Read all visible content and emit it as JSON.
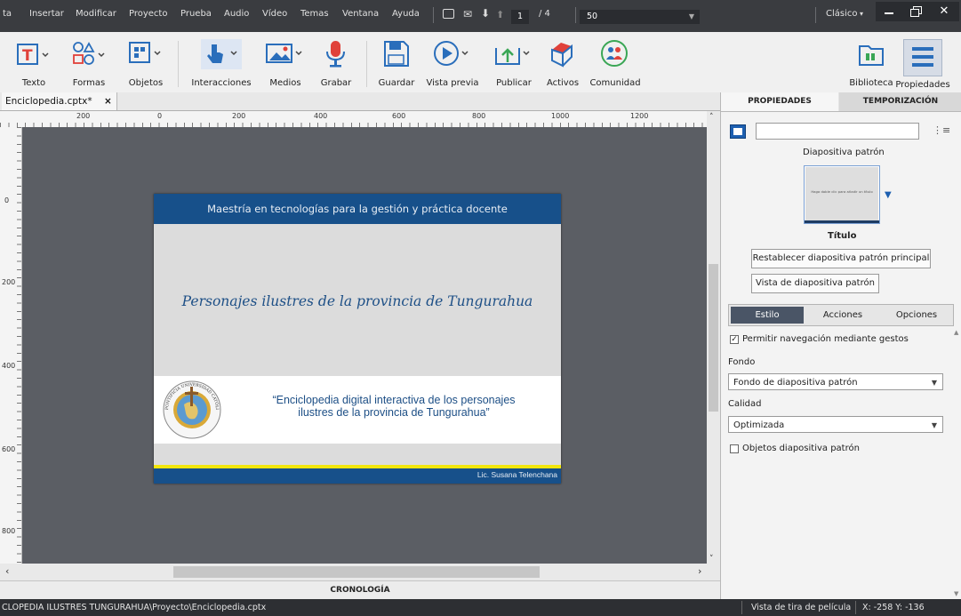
{
  "menubar": {
    "items": [
      "ta",
      "Insertar",
      "Modificar",
      "Proyecto",
      "Prueba",
      "Audio",
      "Vídeo",
      "Temas",
      "Ventana",
      "Ayuda"
    ],
    "current_slide": "1",
    "total_slides": "/ 4",
    "zoom": "50",
    "workspace": "Clásico"
  },
  "toolbar": {
    "texto": "Texto",
    "formas": "Formas",
    "objetos": "Objetos",
    "interacciones": "Interacciones",
    "medios": "Medios",
    "grabar": "Grabar",
    "guardar": "Guardar",
    "vista_previa": "Vista previa",
    "publicar": "Publicar",
    "activos": "Activos",
    "comunidad": "Comunidad",
    "biblioteca": "Biblioteca",
    "propiedades": "Propiedades"
  },
  "document_tab": {
    "name": "Enciclopedia.cptx*",
    "close": "×"
  },
  "ruler": {
    "h_labels": [
      "200",
      "0",
      "200",
      "400",
      "600",
      "800",
      "1000",
      "1200"
    ],
    "v_labels": [
      "0",
      "200",
      "400",
      "600",
      "800"
    ]
  },
  "slide": {
    "header": "Maestría en tecnologías para la gestión y práctica docente",
    "title": "Personajes ilustres de la provincia de Tungurahua",
    "quote_line1": "“Enciclopedia digital interactiva de los personajes",
    "quote_line2": "ilustres de la provincia de Tungurahua”",
    "author": "Lic. Susana Telenchana",
    "logo_text": "PONTIFICIA UNIVERSIDAD CATÓLICA DEL ECUADOR"
  },
  "timeline": {
    "label": "CRONOLOGÍA"
  },
  "panel": {
    "tab_properties": "PROPIEDADES",
    "tab_timing": "TEMPORIZACIÓN",
    "name_value": "",
    "master_label": "Diapositiva patrón",
    "thumb_text": "Haga doble clic para añadir un título",
    "master_name": "Título",
    "reset_button": "Restablecer diapositiva patrón principal",
    "master_view_button": "Vista de diapositiva patrón",
    "subtabs": [
      "Estilo",
      "Acciones",
      "Opciones"
    ],
    "gestures_label": "Permitir navegación mediante gestos",
    "gestures_checked": true,
    "fondo_label": "Fondo",
    "fondo_value": "Fondo de diapositiva patrón",
    "calidad_label": "Calidad",
    "calidad_value": "Optimizada",
    "master_objects_label": "Objetos diapositiva patrón",
    "master_objects_checked": false
  },
  "status": {
    "path": "CLOPEDIA ILUSTRES TUNGURAHUA\\Proyecto\\Enciclopedia.cptx",
    "view": "Vista de tira de película",
    "coords": "X: -258 Y: -136"
  },
  "colors": {
    "slide_blue": "#17508a",
    "accent_yellow": "#f2e60c",
    "toolbar_icon_blue": "#2a6ebb",
    "record_red": "#e0413a",
    "community_green": "#3aa655"
  }
}
